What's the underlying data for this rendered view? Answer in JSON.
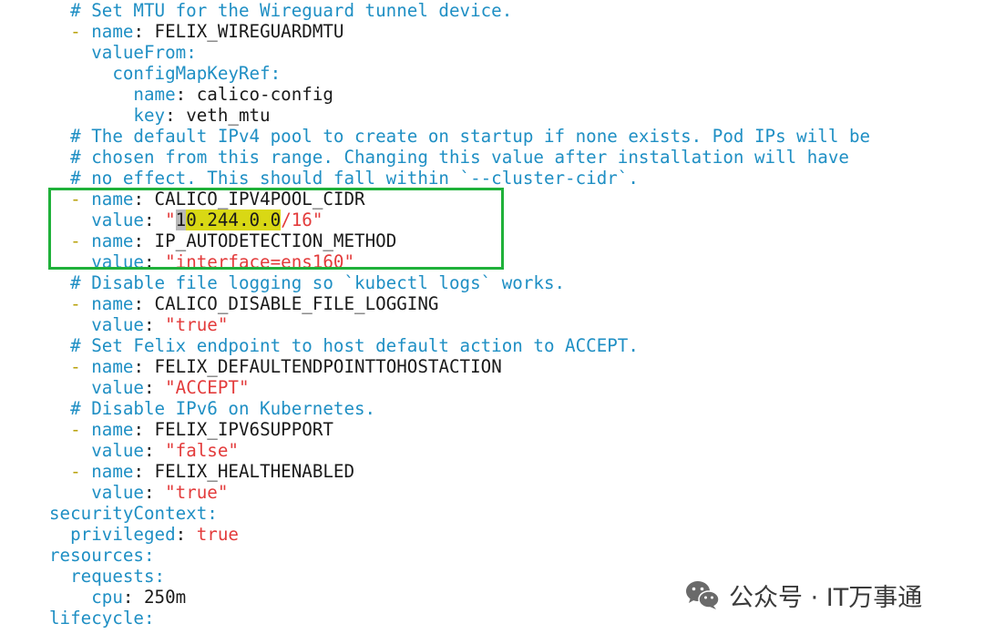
{
  "editor": {
    "l1": {
      "indent": "  ",
      "comment": "# Set MTU for the Wireguard tunnel device."
    },
    "l2": {
      "indent": "  ",
      "dash": "- ",
      "key": "name",
      "colon": ": ",
      "val": "FELIX_WIREGUARDMTU"
    },
    "l3": {
      "indent": "    ",
      "key": "valueFrom",
      "colon": ":"
    },
    "l4": {
      "indent": "      ",
      "key": "configMapKeyRef",
      "colon": ":"
    },
    "l5": {
      "indent": "        ",
      "key": "name",
      "colon": ": ",
      "val": "calico-config"
    },
    "l6": {
      "indent": "        ",
      "key": "key",
      "colon": ": ",
      "val": "veth_mtu"
    },
    "l7": {
      "indent": "  ",
      "comment": "# The default IPv4 pool to create on startup if none exists. Pod IPs will be"
    },
    "l8": {
      "indent": "  ",
      "comment": "# chosen from this range. Changing this value after installation will have"
    },
    "l9": {
      "indent": "  ",
      "comment": "# no effect. This should fall within `--cluster-cidr`."
    },
    "l10": {
      "indent": "  ",
      "dash": "- ",
      "key": "name",
      "colon": ": ",
      "val": "CALICO_IPV4POOL_CIDR"
    },
    "l11": {
      "indent": "    ",
      "key": "value",
      "colon": ": ",
      "q1": "\"",
      "cursor_char": "1",
      "hl_text": "0.244.0.0",
      "rest": "/16\""
    },
    "l12": {
      "indent": "  ",
      "dash": "- ",
      "key": "name",
      "colon": ": ",
      "val": "IP_AUTODETECTION_METHOD"
    },
    "l13": {
      "indent": "    ",
      "key": "value",
      "colon": ": ",
      "str": "\"interface=ens160\""
    },
    "l14": {
      "indent": "  ",
      "comment": "# Disable file logging so `kubectl logs` works."
    },
    "l15": {
      "indent": "  ",
      "dash": "- ",
      "key": "name",
      "colon": ": ",
      "val": "CALICO_DISABLE_FILE_LOGGING"
    },
    "l16": {
      "indent": "    ",
      "key": "value",
      "colon": ": ",
      "str": "\"true\""
    },
    "l17": {
      "indent": "  ",
      "comment": "# Set Felix endpoint to host default action to ACCEPT."
    },
    "l18": {
      "indent": "  ",
      "dash": "- ",
      "key": "name",
      "colon": ": ",
      "val": "FELIX_DEFAULTENDPOINTTOHOSTACTION"
    },
    "l19": {
      "indent": "    ",
      "key": "value",
      "colon": ": ",
      "str": "\"ACCEPT\""
    },
    "l20": {
      "indent": "  ",
      "comment": "# Disable IPv6 on Kubernetes."
    },
    "l21": {
      "indent": "  ",
      "dash": "- ",
      "key": "name",
      "colon": ": ",
      "val": "FELIX_IPV6SUPPORT"
    },
    "l22": {
      "indent": "    ",
      "key": "value",
      "colon": ": ",
      "str": "\"false\""
    },
    "l23": {
      "indent": "  ",
      "dash": "- ",
      "key": "name",
      "colon": ": ",
      "val": "FELIX_HEALTHENABLED"
    },
    "l24": {
      "indent": "    ",
      "key": "value",
      "colon": ": ",
      "str": "\"true\""
    },
    "l25": {
      "indent": "",
      "key": "securityContext",
      "colon": ":"
    },
    "l26": {
      "indent": "  ",
      "key": "privileged",
      "colon": ": ",
      "bool": "true"
    },
    "l27": {
      "indent": "",
      "key": "resources",
      "colon": ":"
    },
    "l28": {
      "indent": "  ",
      "key": "requests",
      "colon": ":"
    },
    "l29": {
      "indent": "    ",
      "key": "cpu",
      "colon": ": ",
      "val": "250m"
    },
    "l30": {
      "indent": "",
      "key": "lifecycle",
      "colon": ":"
    }
  },
  "watermark": {
    "icon": "wechat-icon",
    "text": "公众号 · IT万事通"
  },
  "colors": {
    "comment": "#1f8fc4",
    "key": "#1f8fc4",
    "dash": "#b8a10a",
    "string": "#e33b3b",
    "highlight": "#d9d814",
    "box": "#1fb13a"
  }
}
